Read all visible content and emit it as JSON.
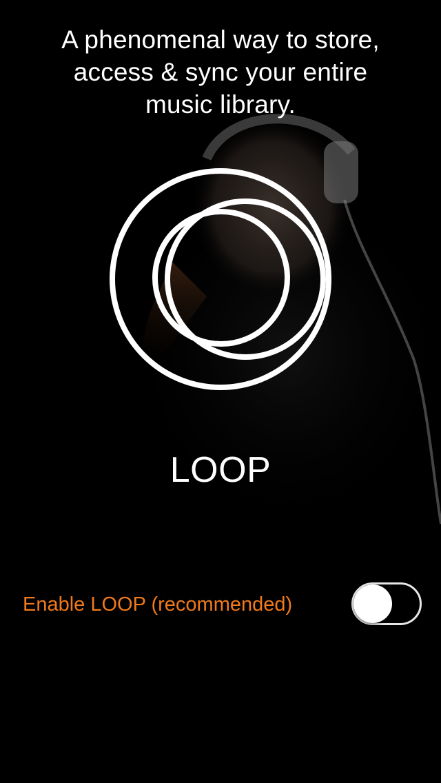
{
  "intro": {
    "headline_line1": "A phenomenal way to store,",
    "headline_line2": "access & sync your entire",
    "headline_line3": "music library."
  },
  "brand": {
    "name": "LOOP",
    "logo_icon": "loop-rings-icon"
  },
  "settings": {
    "enable_label": "Enable LOOP (recommended)",
    "enable_toggle_on": false
  },
  "colors": {
    "background": "#000000",
    "text": "#ffffff",
    "accent": "#f07a1c",
    "toggle_border": "#e6e6e6"
  }
}
